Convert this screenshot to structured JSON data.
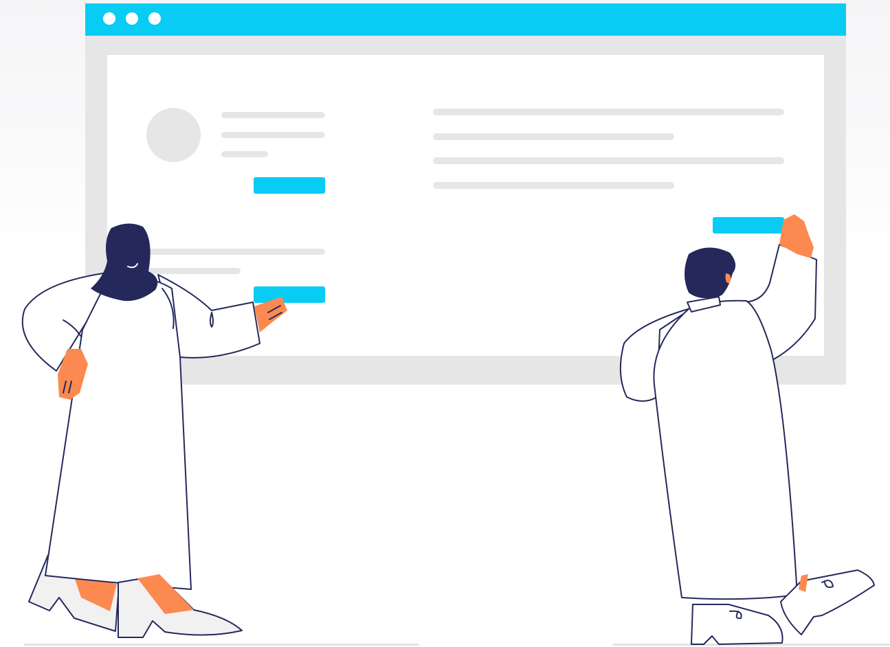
{
  "colors": {
    "accent": "#09ccf4",
    "placeholder": "#e6e6e6",
    "frame": "#e6e6e6",
    "skin": "#fc8a50",
    "hair": "#24285b",
    "outline": "#24285b",
    "clothing": "#ffffff",
    "shoe": "#f1f1f1"
  },
  "window": {
    "controls": [
      "dot",
      "dot",
      "dot"
    ]
  },
  "illustration": {
    "figures": [
      "person-left",
      "person-right"
    ]
  }
}
